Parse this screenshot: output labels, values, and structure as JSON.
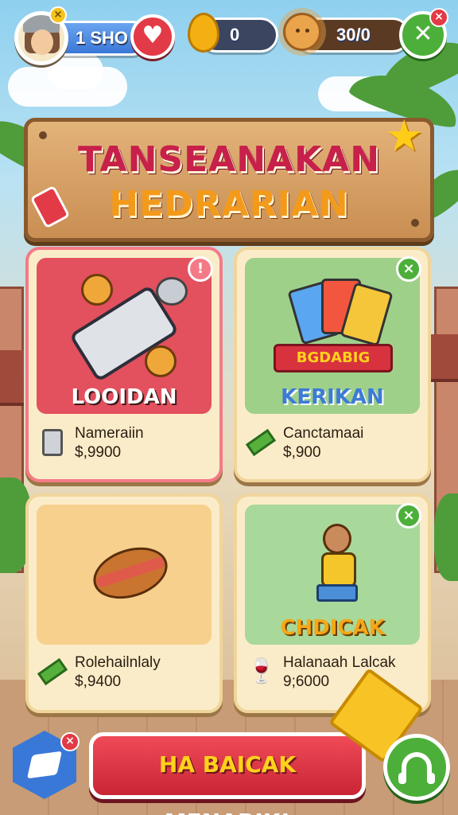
{
  "hud": {
    "level_label": "1 SHO",
    "balloons_count": "0",
    "suns_count": "30/0",
    "avatar_badge": "×",
    "close_badge": "×"
  },
  "banner": {
    "line1": "TANSEANAKAN",
    "line2": "HEDRARIAN"
  },
  "cards": [
    {
      "title": "LOOIDAN",
      "name": "Nameraiin",
      "price": "$,9900",
      "corner": "!",
      "bg_color": "#e3505e",
      "title_color": "#ffffff"
    },
    {
      "title": "KERIKAN",
      "art_label": "BGDABIG",
      "name": "Canctamaai",
      "price": "$,900",
      "corner": "×",
      "bg_color": "#9fd08a",
      "title_color": "#3c7bd6"
    },
    {
      "title": "",
      "name": "Rolehailnlaly",
      "price": "$,9400",
      "corner": "",
      "bg_color": "#f6d08c",
      "title_color": "#ffffff"
    },
    {
      "title": "CHDICAK",
      "name": "Halanaah Lalcak",
      "price": "9;6000",
      "corner": "×",
      "bg_color": "#a8d89a",
      "title_color": "#f4a817"
    }
  ],
  "bottom": {
    "cta_part1": "HA BAICAK",
    "cta_part2": " MENARIK!",
    "hex_badge": "×"
  },
  "colors": {
    "accent_red": "#e23a46",
    "accent_green": "#4caf3a",
    "accent_blue": "#3a78d8",
    "gold": "#f4b012"
  },
  "icons": [
    "heart-icon",
    "balloon-icon",
    "sun-icon",
    "close-icon",
    "star-icon",
    "flag-icon",
    "can-icon",
    "cash-icon",
    "goblet-icon",
    "kite-icon",
    "headset-icon",
    "eraser-icon"
  ]
}
